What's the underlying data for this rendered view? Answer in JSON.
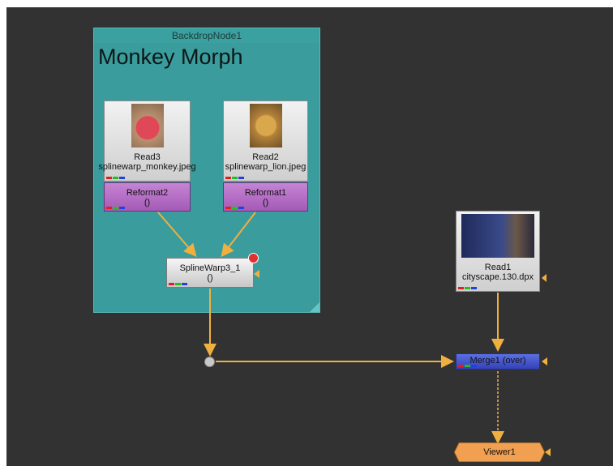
{
  "backdrop": {
    "header": "BackdropNode1",
    "title": "Monkey Morph"
  },
  "nodes": {
    "read3": {
      "name": "Read3",
      "file": "splinewarp_monkey.jpeg"
    },
    "read2": {
      "name": "Read2",
      "file": "splinewarp_lion.jpeg"
    },
    "reformat2": {
      "name": "Reformat2",
      "detail": "()"
    },
    "reformat1": {
      "name": "Reformat1",
      "detail": "()"
    },
    "splinewarp": {
      "name": "SplineWarp3_1",
      "detail": "()"
    },
    "read1": {
      "name": "Read1",
      "file": "cityscape.130.dpx"
    },
    "merge": {
      "name": "Merge1 (over)"
    },
    "viewer": {
      "name": "Viewer1"
    }
  },
  "colors": {
    "graph_bg": "#323232",
    "backdrop": "#3a9c9c",
    "reformat": "#b36cc4",
    "merge": "#3f4ec8",
    "viewer": "#f0a050",
    "pipe": "#f0b040"
  }
}
